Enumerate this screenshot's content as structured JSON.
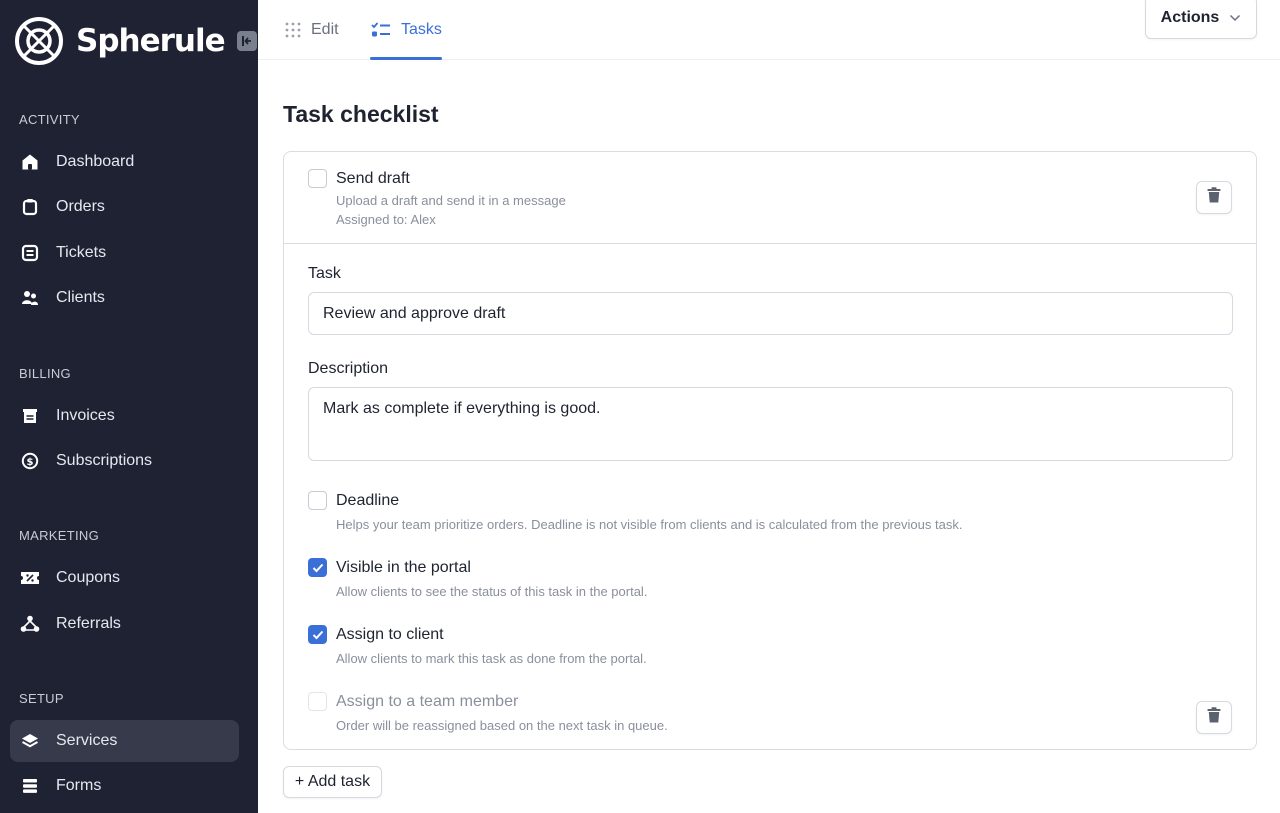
{
  "app": {
    "name": "Spherule"
  },
  "sidebar": {
    "sections": [
      {
        "title": "ACTIVITY",
        "items": [
          {
            "label": "Dashboard",
            "icon": "home-icon"
          },
          {
            "label": "Orders",
            "icon": "clipboard-icon"
          },
          {
            "label": "Tickets",
            "icon": "ticket-icon"
          },
          {
            "label": "Clients",
            "icon": "users-icon"
          }
        ]
      },
      {
        "title": "BILLING",
        "items": [
          {
            "label": "Invoices",
            "icon": "receipt-icon"
          },
          {
            "label": "Subscriptions",
            "icon": "dollar-cycle-icon"
          }
        ]
      },
      {
        "title": "MARKETING",
        "items": [
          {
            "label": "Coupons",
            "icon": "coupon-icon"
          },
          {
            "label": "Referrals",
            "icon": "share-icon"
          }
        ]
      },
      {
        "title": "SETUP",
        "items": [
          {
            "label": "Services",
            "icon": "layers-icon",
            "active": true
          },
          {
            "label": "Forms",
            "icon": "list-icon"
          }
        ]
      }
    ]
  },
  "topbar": {
    "tabs": [
      {
        "label": "Edit",
        "icon": "grip-icon",
        "active": false
      },
      {
        "label": "Tasks",
        "icon": "checklist-icon",
        "active": true
      }
    ],
    "actions_label": "Actions"
  },
  "main": {
    "title": "Task checklist",
    "existing_task": {
      "title": "Send draft",
      "description": "Upload a draft and send it in a message",
      "assigned": "Assigned to: Alex",
      "checked": false
    },
    "form": {
      "task_label": "Task",
      "task_value": "Review and approve draft",
      "description_label": "Description",
      "description_value": "Mark as complete if everything is good.",
      "options": [
        {
          "title": "Deadline",
          "sub": "Helps your team prioritize orders. Deadline is not visible from clients and is calculated from the previous task.",
          "checked": false,
          "disabled": false
        },
        {
          "title": "Visible in the portal",
          "sub": "Allow clients to see the status of this task in the portal.",
          "checked": true,
          "disabled": false
        },
        {
          "title": "Assign to client",
          "sub": "Allow clients to mark this task as done from the portal.",
          "checked": true,
          "disabled": false
        },
        {
          "title": "Assign to a team member",
          "sub": "Order will be reassigned based on the next task in queue.",
          "checked": false,
          "disabled": true
        }
      ]
    },
    "add_task_label": "+ Add task"
  },
  "colors": {
    "sidebar_bg": "#1e2233",
    "accent": "#3b6fd8"
  }
}
